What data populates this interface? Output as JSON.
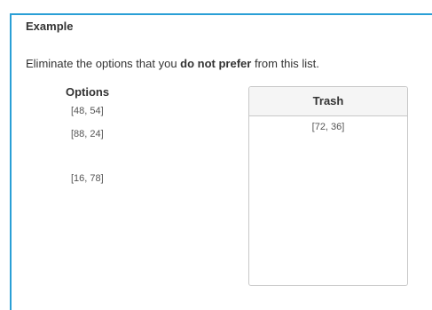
{
  "title": "Example",
  "instruction": {
    "before": "Eliminate the options that you ",
    "bold": "do not prefer",
    "after": " from this list."
  },
  "options": {
    "header": "Options",
    "items": [
      "[48, 54]",
      "[88, 24]",
      "[16, 78]"
    ]
  },
  "trash": {
    "header": "Trash",
    "items": [
      "[72, 36]"
    ]
  },
  "colors": {
    "accent": "#2a9fd6",
    "border": "#c8c8c8",
    "header_bg": "#f5f5f5"
  }
}
